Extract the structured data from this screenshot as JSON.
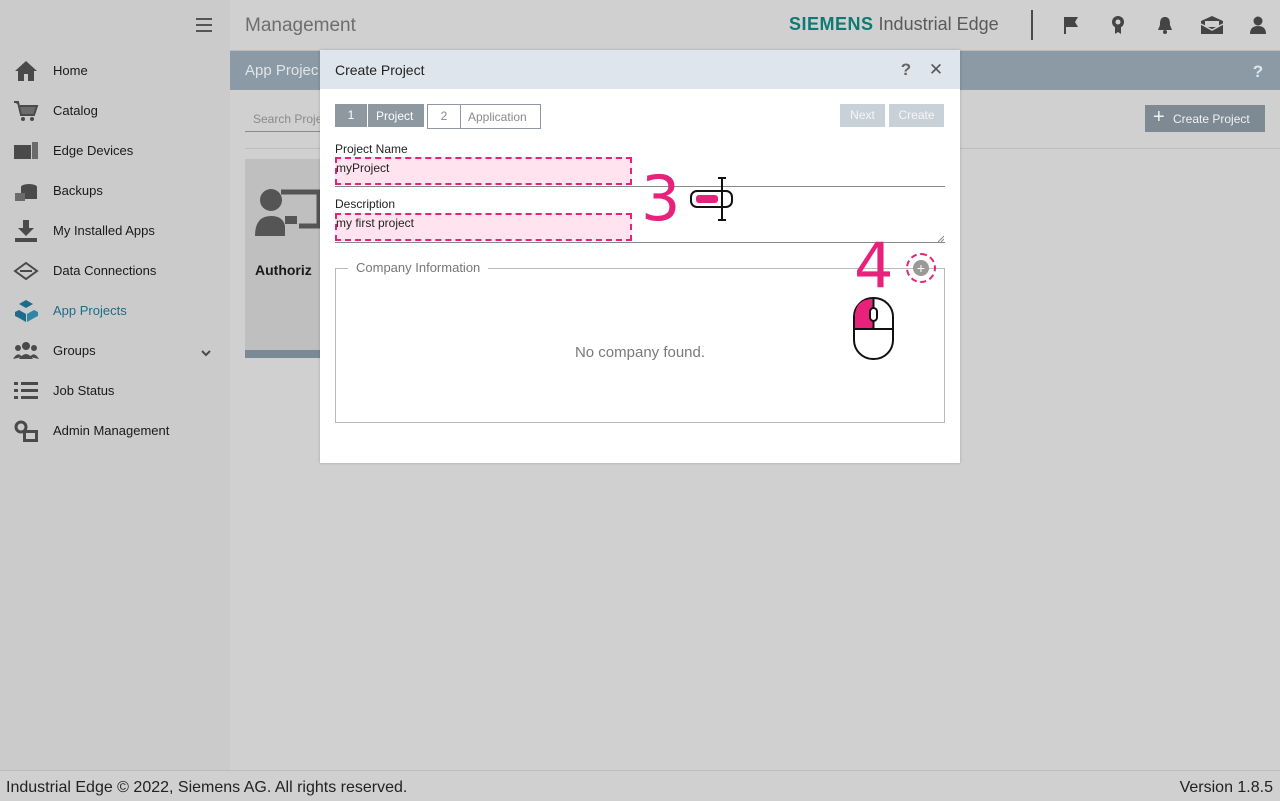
{
  "header": {
    "page_title": "Management",
    "brand_siemens": "SIEMENS",
    "brand_product": "Industrial Edge",
    "icons": [
      "flag-icon",
      "badge-icon",
      "bell-icon",
      "inbox-icon",
      "user-icon"
    ]
  },
  "sidebar": {
    "items": [
      {
        "label": "Home",
        "icon": "home-icon"
      },
      {
        "label": "Catalog",
        "icon": "cart-icon"
      },
      {
        "label": "Edge Devices",
        "icon": "device-icon"
      },
      {
        "label": "Backups",
        "icon": "backup-icon"
      },
      {
        "label": "My Installed Apps",
        "icon": "download-icon"
      },
      {
        "label": "Data Connections",
        "icon": "connection-icon"
      },
      {
        "label": "App Projects",
        "icon": "cubes-icon",
        "active": true
      },
      {
        "label": "Groups",
        "icon": "group-icon"
      },
      {
        "label": "Job Status",
        "icon": "list-icon"
      },
      {
        "label": "Admin Management",
        "icon": "admin-icon"
      }
    ]
  },
  "subheader": {
    "title": "App Projec",
    "help": "?"
  },
  "toolbar": {
    "search_placeholder": "Search Proje",
    "create_project": "Create Project"
  },
  "card": {
    "label": "Authoriz"
  },
  "dialog": {
    "title": "Create Project",
    "help": "?",
    "close": "✕",
    "steps": [
      {
        "num": "1",
        "label": "Project"
      },
      {
        "num": "2",
        "label": "Application"
      }
    ],
    "next": "Next",
    "create": "Create",
    "project_name_label": "Project Name",
    "project_name_value": "myProject",
    "description_label": "Description",
    "description_value": "my first project",
    "company_legend": "Company Information",
    "no_company": "No company found.",
    "add_symbol": "+"
  },
  "annotations": {
    "step3": "3",
    "step4": "4"
  },
  "footer": {
    "copyright": "Industrial Edge © 2022, Siemens AG. All rights reserved.",
    "version": "Version 1.8.5"
  },
  "colors": {
    "accent": "#e8217a",
    "brand": "#0e7a76",
    "active_nav": "#1f6b8a"
  }
}
